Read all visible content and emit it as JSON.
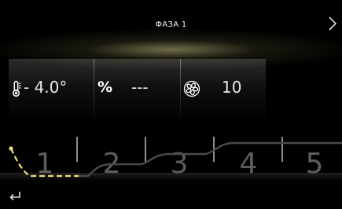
{
  "header": {
    "title": "ФАЗА 1",
    "next_icon": "chevron-right-icon"
  },
  "params": {
    "temperature": {
      "icon": "thermometer-icon",
      "value": "- 4.0°"
    },
    "humidity": {
      "symbol": "%",
      "value": "---"
    },
    "fan": {
      "icon": "fan-icon",
      "value": "10"
    }
  },
  "phases": {
    "labels": [
      "1",
      "2",
      "3",
      "4",
      "5"
    ],
    "active": 1,
    "active_color": "#f0e07a"
  },
  "footer": {
    "back_icon": "return-arrow-icon"
  }
}
